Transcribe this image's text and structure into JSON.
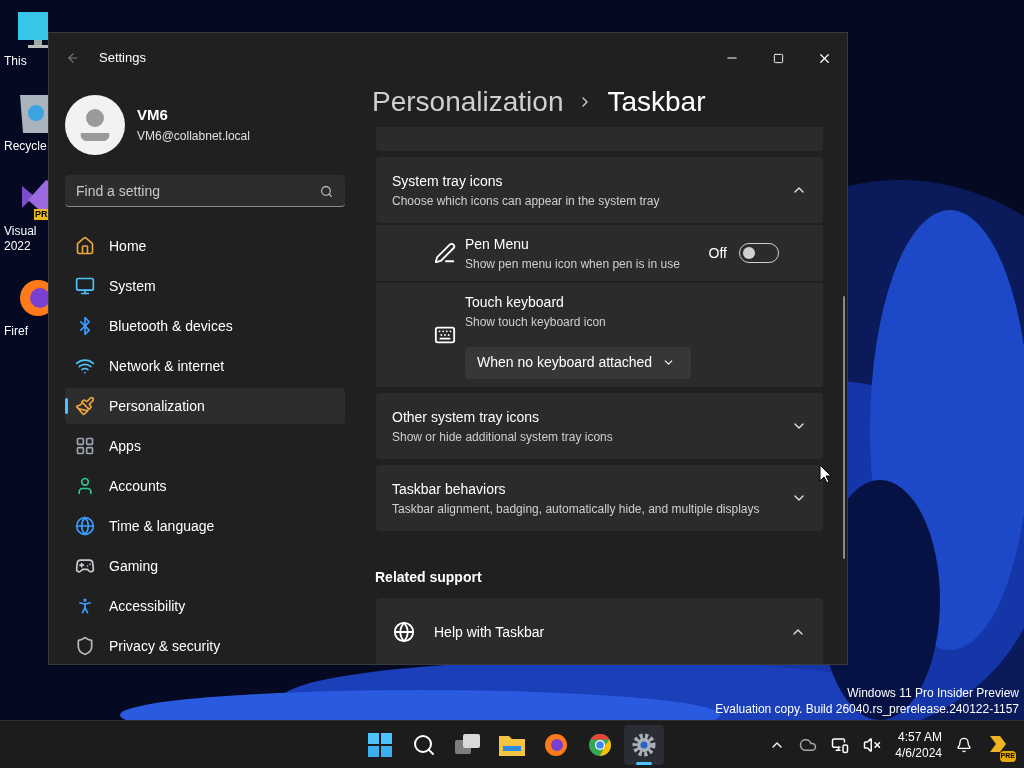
{
  "desktop": {
    "icons": [
      {
        "kind": "pc",
        "lines": [
          "This"
        ]
      },
      {
        "kind": "bin",
        "lines": [
          "Recycle"
        ]
      },
      {
        "kind": "vs",
        "lines": [
          "Visual",
          "2022"
        ],
        "badge": "PR"
      },
      {
        "kind": "firefox",
        "lines": [
          "Firef"
        ]
      }
    ],
    "watermark": [
      "Windows 11 Pro Insider Preview",
      "Evaluation copy. Build 26040.rs_prerelease.240122-1157"
    ]
  },
  "window": {
    "title": "Settings"
  },
  "profile": {
    "name": "VM6",
    "email": "VM6@collabnet.local"
  },
  "search": {
    "placeholder": "Find a setting"
  },
  "sidebar": {
    "items": [
      {
        "kind": "home",
        "label": "Home",
        "selected": false
      },
      {
        "kind": "system",
        "label": "System",
        "selected": false
      },
      {
        "kind": "bluetooth",
        "label": "Bluetooth & devices",
        "selected": false
      },
      {
        "kind": "network",
        "label": "Network & internet",
        "selected": false
      },
      {
        "kind": "brush",
        "label": "Personalization",
        "selected": true
      },
      {
        "kind": "apps",
        "label": "Apps",
        "selected": false
      },
      {
        "kind": "accounts",
        "label": "Accounts",
        "selected": false
      },
      {
        "kind": "time",
        "label": "Time & language",
        "selected": false
      },
      {
        "kind": "gaming",
        "label": "Gaming",
        "selected": false
      },
      {
        "kind": "accessibility",
        "label": "Accessibility",
        "selected": false
      },
      {
        "kind": "privacy",
        "label": "Privacy & security",
        "selected": false
      }
    ]
  },
  "breadcrumb": [
    "Personalization",
    "Taskbar"
  ],
  "sections": [
    {
      "title": "System tray icons",
      "subtitle": "Choose which icons can appear in the system tray",
      "expanded": true,
      "children": [
        {
          "kind": "toggle",
          "title": "Pen Menu",
          "subtitle": "Show pen menu icon when pen is in use",
          "state_label": "Off",
          "on": false
        },
        {
          "kind": "dropdown",
          "title": "Touch keyboard",
          "subtitle": "Show touch keyboard icon",
          "value": "When no keyboard attached"
        }
      ]
    },
    {
      "title": "Other system tray icons",
      "subtitle": "Show or hide additional system tray icons",
      "expanded": false
    },
    {
      "title": "Taskbar behaviors",
      "subtitle": "Taskbar alignment, badging, automatically hide, and multiple displays",
      "expanded": false
    }
  ],
  "related_support": {
    "heading": "Related support",
    "items": [
      {
        "title": "Help with Taskbar",
        "expanded": true
      }
    ]
  },
  "taskbar": {
    "apps": [
      {
        "kind": "start",
        "active": false
      },
      {
        "kind": "search",
        "active": false
      },
      {
        "kind": "taskview",
        "active": false
      },
      {
        "kind": "explorer",
        "active": false
      },
      {
        "kind": "firefox",
        "active": false
      },
      {
        "kind": "chrome",
        "active": false
      },
      {
        "kind": "settings",
        "active": true
      }
    ],
    "time": "4:57 AM",
    "date": "4/6/2024",
    "copilot_badge": "PRE"
  }
}
